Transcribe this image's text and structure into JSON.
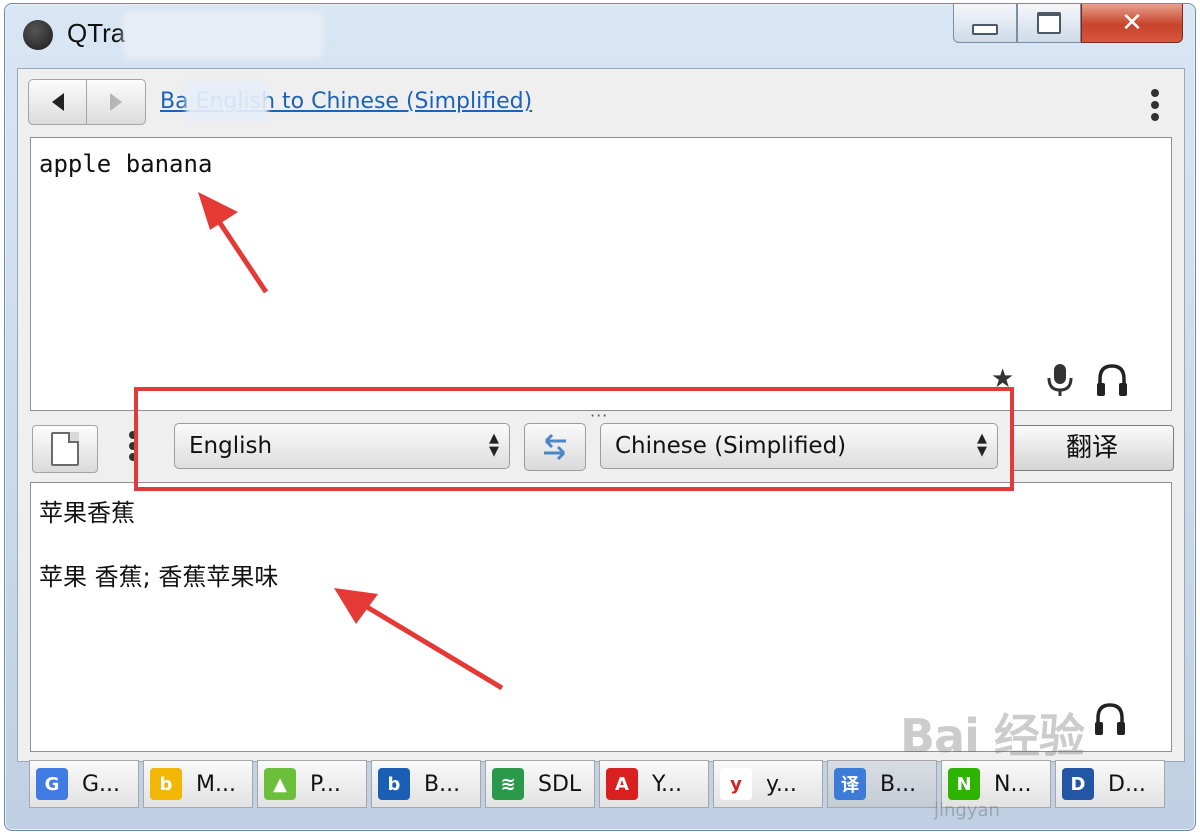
{
  "window": {
    "title": "QTra",
    "min_icon": "minimize-icon",
    "max_icon": "maximize-icon",
    "close_glyph": "✕"
  },
  "toolbar": {
    "back_icon": "back-arrow-icon",
    "forward_icon": "forward-arrow-icon",
    "breadcrumb": "Ba         English to Chinese (Simplified)",
    "menu_icon": "kebab-menu-icon"
  },
  "source": {
    "text": "apple banana"
  },
  "language_bar": {
    "source_language": "English",
    "target_language": "Chinese (Simplified)",
    "swap_icon": "swap-icon",
    "translate_label": "翻译",
    "grip": "···"
  },
  "result": {
    "line1": "苹果香蕉",
    "line2": "苹果 香蕉; 香蕉苹果味"
  },
  "engines": [
    {
      "label": "G...",
      "icon": "google-translate-icon",
      "color": "#3f7be3",
      "glyph": "G"
    },
    {
      "label": "M...",
      "icon": "bing-icon",
      "color": "#f2b705",
      "glyph": "b"
    },
    {
      "label": "P...",
      "icon": "promt-icon",
      "color": "#6bbf3a",
      "glyph": "▲"
    },
    {
      "label": "B...",
      "icon": "babylon-icon",
      "color": "#1a5fb4",
      "glyph": "b"
    },
    {
      "label": "SDL",
      "icon": "sdl-icon",
      "color": "#2a9a4a",
      "glyph": "≋"
    },
    {
      "label": "Y...",
      "icon": "yandex-icon",
      "color": "#d82020",
      "glyph": "A"
    },
    {
      "label": "y...",
      "icon": "youdao-icon",
      "color": "#ffffff",
      "glyph": "y"
    },
    {
      "label": "B...",
      "icon": "baidu-translate-icon",
      "color": "#3d7bd8",
      "glyph": "译"
    },
    {
      "label": "N...",
      "icon": "naver-icon",
      "color": "#2db400",
      "glyph": "N"
    },
    {
      "label": "D...",
      "icon": "deepl-icon",
      "color": "#2357a6",
      "glyph": "D"
    }
  ],
  "watermark": {
    "text": "Bai 经验",
    "sub": "jingyan"
  }
}
